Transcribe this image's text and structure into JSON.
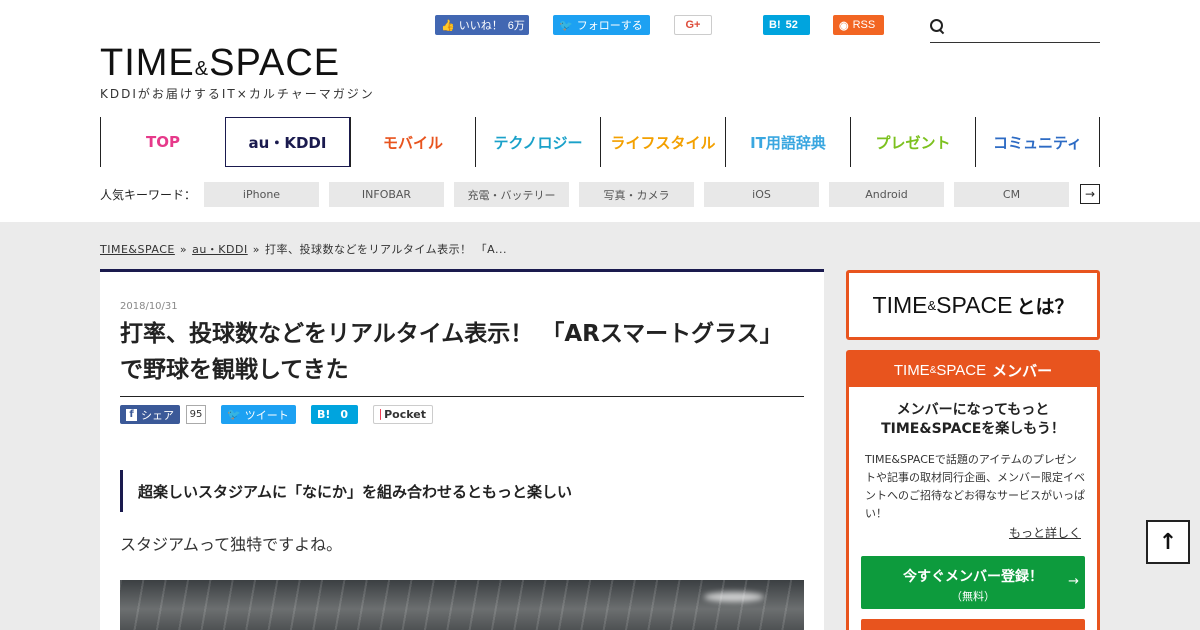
{
  "header": {
    "logo": {
      "part1": "TIME",
      "amp": "&",
      "part2": "SPACE"
    },
    "tagline": "KDDIがお届けするIT×カルチャーマガジン",
    "social": {
      "facebook": {
        "label": "いいね！",
        "count": "6万"
      },
      "twitter": {
        "label": "フォローする"
      },
      "gplus": {
        "label": "G+"
      },
      "hatena": {
        "label": "B!",
        "count": "52"
      },
      "rss": {
        "label": "RSS"
      }
    },
    "search": {
      "placeholder": ""
    }
  },
  "gnav": {
    "items": [
      {
        "label": "TOP",
        "color": "#e6398a"
      },
      {
        "label": "au・KDDI",
        "color": "#1a1a4e"
      },
      {
        "label": "モバイル",
        "color": "#e8541e"
      },
      {
        "label": "テクノロジー",
        "color": "#1aa1c9"
      },
      {
        "label": "ライフスタイル",
        "color": "#f3a000"
      },
      {
        "label": "IT用語辞典",
        "color": "#3aa7e0"
      },
      {
        "label": "プレゼント",
        "color": "#7cc11f"
      },
      {
        "label": "コミュニティ",
        "color": "#2d6bc4"
      }
    ]
  },
  "keywords": {
    "label": "人気キーワード：",
    "tags": [
      "iPhone",
      "INFOBAR",
      "充電・バッテリー",
      "写真・カメラ",
      "iOS",
      "Android",
      "CM"
    ],
    "more": "→"
  },
  "breadcrumb": {
    "home": "TIME&SPACE",
    "sep": "»",
    "category": "au・KDDI",
    "current": "打率、投球数などをリアルタイム表示！ 「A..."
  },
  "article": {
    "date": "2018/10/31",
    "title": "打率、投球数などをリアルタイム表示！ 「ARスマートグラス」で野球を観戦してきた",
    "share": {
      "facebook": {
        "label": "シェア",
        "count": "95"
      },
      "twitter": {
        "label": "ツイート"
      },
      "hatena": {
        "label": "B!",
        "count": "0"
      },
      "pocket": {
        "label": "Pocket"
      }
    },
    "lead": "超楽しいスタジアムに「なにか」を組み合わせるともっと楽しい",
    "body": "スタジアムって独特ですよね。"
  },
  "sidebar": {
    "about": {
      "part1": "TIME",
      "amp": "&",
      "part2": "SPACE",
      "suffix": "とは？"
    },
    "member": {
      "head": {
        "part1": "TIME",
        "amp": "&",
        "part2": "SPACE",
        "suffix": "メンバー"
      },
      "lead_line1": "メンバーになってもっと",
      "lead_line2": "TIME&SPACEを楽しもう！",
      "desc": "TIME&SPACEで話題のアイテムのプレゼントや記事の取材同行企画、メンバー限定イベントへのご招待などお得なサービスがいっぱい！",
      "more": "もっと詳しく",
      "button_main": "今すぐメンバー登録！",
      "button_sub": "（無料）",
      "button_arrow": "→"
    }
  },
  "to_top": "↑"
}
